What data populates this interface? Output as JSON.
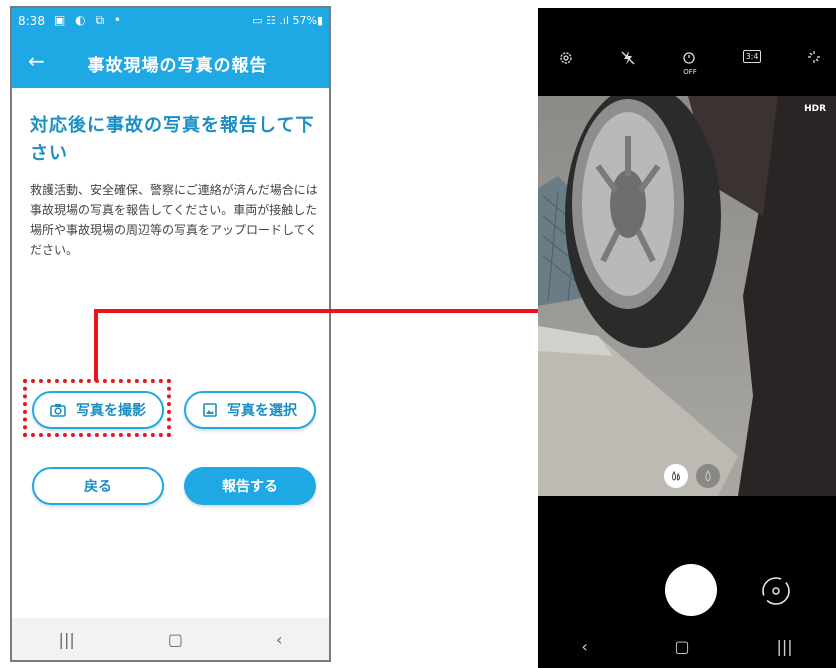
{
  "left_phone": {
    "status": {
      "time": "8:38",
      "icons": "▣ ◐ ⧉ •",
      "right": "▭ ☷ .ıl 57%▮"
    },
    "appbar": {
      "back": "←",
      "title": "事故現場の写真の報告"
    },
    "heading": "対応後に事故の写真を報告して下さい",
    "description": "救護活動、安全確保、警察にご連絡が済んだ場合には事故現場の写真を報告してください。車両が接触した場所や事故現場の周辺等の写真をアップロードしてください。",
    "buttons": {
      "take_photo": "写真を撮影",
      "select_photo": "写真を選択",
      "back": "戻る",
      "report": "報告する"
    },
    "nav": {
      "recent": "|||",
      "home": "▢",
      "back": "‹"
    },
    "colors": {
      "primary": "#1ea8e4",
      "heading": "#1b8fc4",
      "highlight": "#e8141a"
    }
  },
  "right_phone": {
    "toolbar_icons": [
      "gear-icon",
      "flash-off-icon",
      "timer-off-icon",
      "ratio-icon",
      "sparkle-icon"
    ],
    "toolbar_labels": {
      "ratio": "3:4",
      "timer": "OFF"
    },
    "hdr": "HDR",
    "nav": {
      "back": "‹",
      "home": "▢",
      "recent": "|||"
    }
  }
}
